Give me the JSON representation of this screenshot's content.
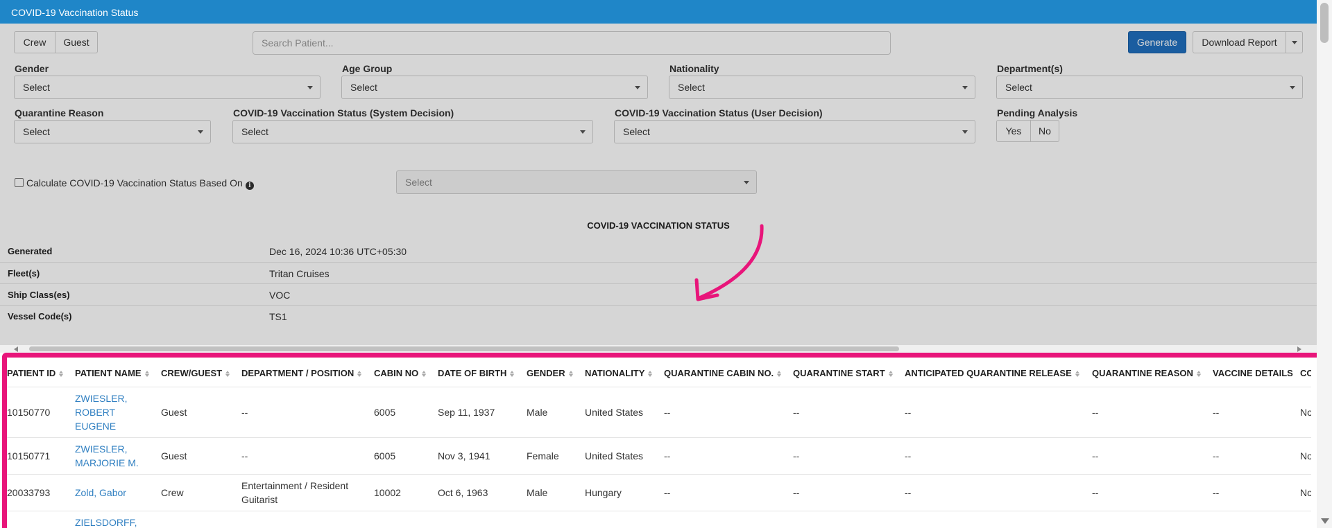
{
  "window": {
    "title": "COVID-19 Vaccination Status"
  },
  "toolbar": {
    "crew_label": "Crew",
    "guest_label": "Guest",
    "search_placeholder": "Search Patient...",
    "generate_label": "Generate",
    "download_label": "Download Report"
  },
  "filters": {
    "gender": {
      "label": "Gender",
      "value": "Select"
    },
    "age_group": {
      "label": "Age Group",
      "value": "Select"
    },
    "nationality": {
      "label": "Nationality",
      "value": "Select"
    },
    "departments": {
      "label": "Department(s)",
      "value": "Select"
    },
    "quarantine_reason": {
      "label": "Quarantine Reason",
      "value": "Select"
    },
    "system_decision": {
      "label": "COVID-19 Vaccination Status (System Decision)",
      "value": "Select"
    },
    "user_decision": {
      "label": "COVID-19 Vaccination Status (User Decision)",
      "value": "Select"
    },
    "pending_analysis": {
      "label": "Pending Analysis",
      "yes": "Yes",
      "no": "No"
    },
    "calculate": {
      "label": "Calculate COVID-19 Vaccination Status Based On",
      "value": "Select"
    }
  },
  "report": {
    "title": "COVID-19 VACCINATION STATUS",
    "meta": [
      {
        "key": "Generated",
        "value": "Dec 16, 2024 10:36 UTC+05:30"
      },
      {
        "key": "Fleet(s)",
        "value": "Tritan Cruises"
      },
      {
        "key": "Ship Class(es)",
        "value": "VOC"
      },
      {
        "key": "Vessel Code(s)",
        "value": "TS1"
      }
    ]
  },
  "table": {
    "columns": [
      "PATIENT ID",
      "PATIENT NAME",
      "CREW/GUEST",
      "DEPARTMENT / POSITION",
      "CABIN NO",
      "DATE OF BIRTH",
      "GENDER",
      "NATIONALITY",
      "QUARANTINE CABIN NO.",
      "QUARANTINE START",
      "ANTICIPATED QUARANTINE RELEASE",
      "QUARANTINE REASON",
      "VACCINE DETAILS",
      "CO"
    ],
    "rows": [
      [
        "10150770",
        "ZWIESLER, ROBERT EUGENE",
        "Guest",
        "--",
        "6005",
        "Sep 11, 1937",
        "Male",
        "United States",
        "--",
        "--",
        "--",
        "--",
        "--",
        "No"
      ],
      [
        "10150771",
        "ZWIESLER, MARJORIE M.",
        "Guest",
        "--",
        "6005",
        "Nov 3, 1941",
        "Female",
        "United States",
        "--",
        "--",
        "--",
        "--",
        "--",
        "No"
      ],
      [
        "20033793",
        "Zold, Gabor",
        "Crew",
        "Entertainment / Resident Guitarist",
        "10002",
        "Oct 6, 1963",
        "Male",
        "Hungary",
        "--",
        "--",
        "--",
        "--",
        "--",
        "No"
      ],
      [
        "",
        "ZIELSDORFF,",
        "",
        "",
        "",
        "",
        "",
        "",
        "",
        "",
        "",
        "",
        "",
        ""
      ]
    ]
  }
}
